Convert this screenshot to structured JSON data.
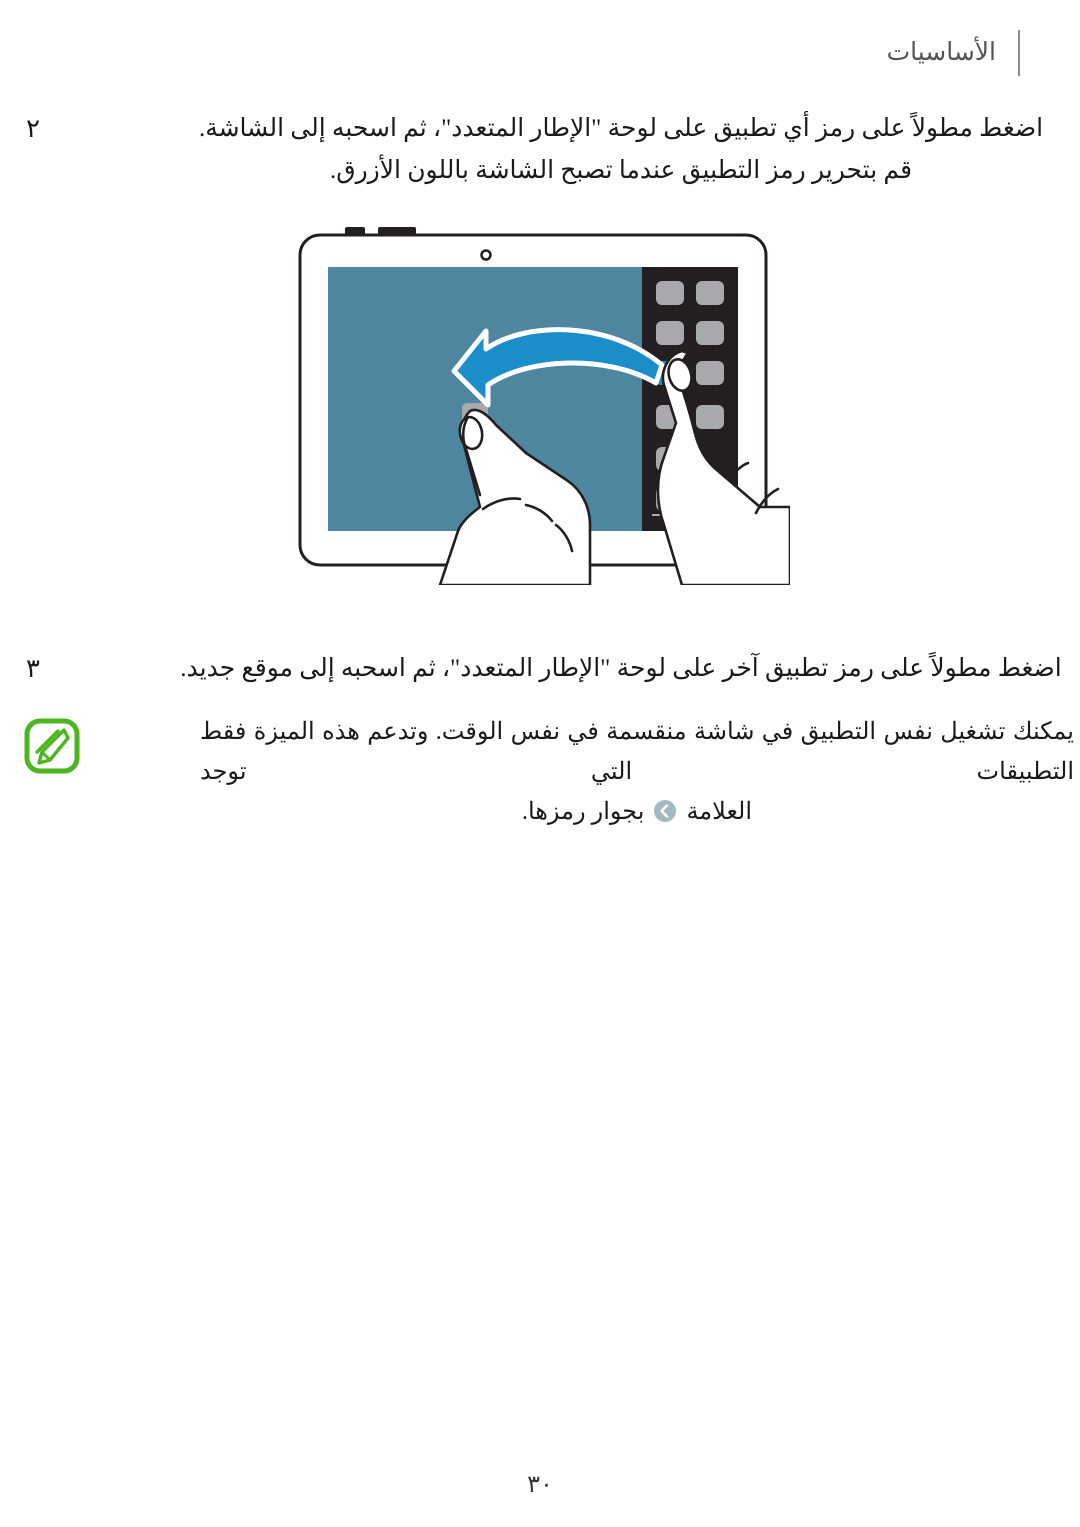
{
  "document": {
    "language": "ar",
    "direction": "rtl"
  },
  "header": {
    "title": "الأساسيات",
    "divider_icon": "vertical-rule-icon"
  },
  "steps": [
    {
      "number": "٢",
      "lines": [
        "اضغط مطولاً على رمز أي تطبيق على لوحة \"الإطار المتعدد\"، ثم اسحبه إلى الشاشة.",
        "قم بتحرير رمز التطبيق عندما تصبح الشاشة باللون الأزرق."
      ]
    },
    {
      "number": "٣",
      "lines": [
        "اضغط مطولاً على رمز تطبيق آخر على لوحة \"الإطار المتعدد\"، ثم اسحبه إلى موقع جديد."
      ]
    }
  ],
  "illustration": {
    "name": "tablet-multiwindow-drag-illustration",
    "device": "tablet",
    "screen_color": "#4E86A0",
    "panel_color": "#231F20",
    "app_icon_color": "#A7A9AC",
    "arrow_color": "#1B8DC8",
    "arrow_outline_color": "#FFFFFF",
    "highlight_color": "#1B8DC8",
    "bezel_color": "#FFFFFF",
    "outline_color": "#231F20",
    "app_icon_rows": 6,
    "app_icon_columns": 2,
    "camera_icon": "front-camera-dot-icon",
    "hands": 2
  },
  "note": {
    "icon": "note-pencil-icon",
    "icon_color": "#4CB520",
    "lines": [
      "يمكنك تشغيل نفس التطبيق في شاشة منقسمة في نفس الوقت. وتدعم هذه الميزة فقط التطبيقات التي توجد",
      "العلامة  بجوار رمزها."
    ],
    "inline_badge": {
      "icon": "chevron-left-badge-icon",
      "circle_color": "#A3B9C1",
      "glyph_color": "#FFFFFF"
    }
  },
  "footer": {
    "page_number": "٣٠"
  }
}
